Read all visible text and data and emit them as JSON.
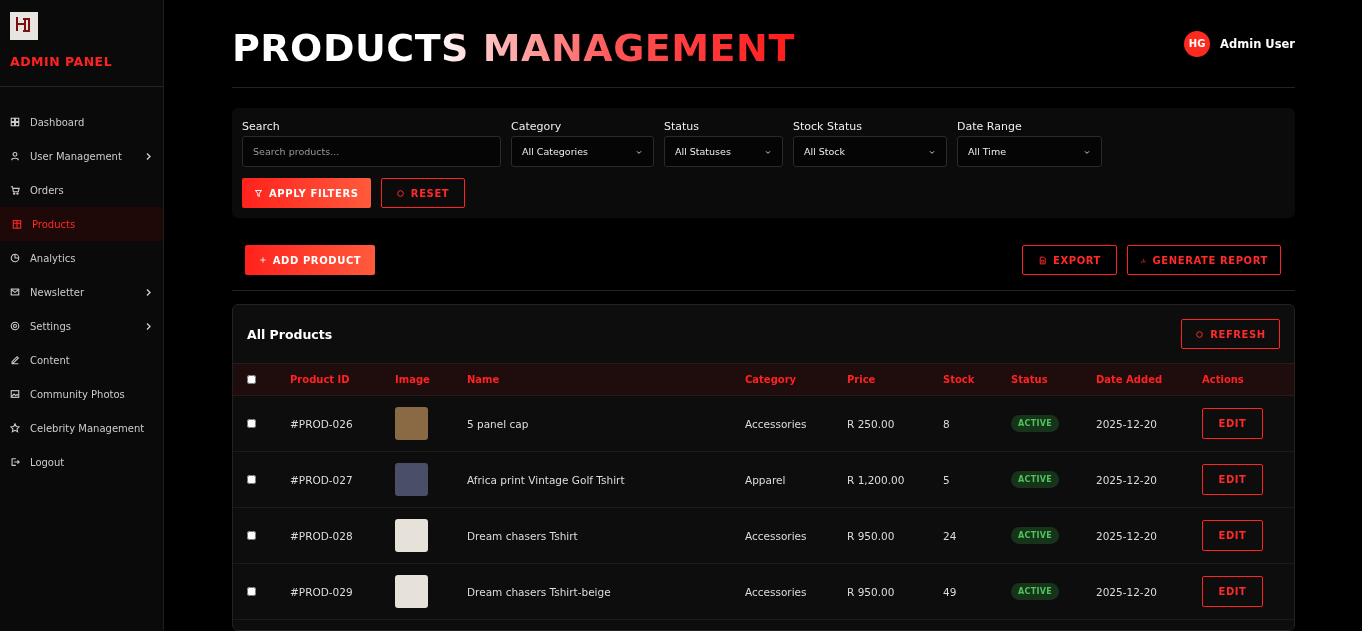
{
  "sidebar": {
    "title": "ADMIN PANEL",
    "items": [
      {
        "label": "Dashboard",
        "submenu": false,
        "selected": false
      },
      {
        "label": "User Management",
        "submenu": true,
        "selected": false
      },
      {
        "label": "Orders",
        "submenu": false,
        "selected": false
      },
      {
        "label": "Products",
        "submenu": false,
        "selected": true
      },
      {
        "label": "Analytics",
        "submenu": false,
        "selected": false
      },
      {
        "label": "Newsletter",
        "submenu": true,
        "selected": false
      },
      {
        "label": "Settings",
        "submenu": true,
        "selected": false
      },
      {
        "label": "Content",
        "submenu": false,
        "selected": false
      },
      {
        "label": "Community Photos",
        "submenu": false,
        "selected": false
      },
      {
        "label": "Celebrity Management",
        "submenu": false,
        "selected": false
      },
      {
        "label": "Logout",
        "submenu": false,
        "selected": false
      }
    ]
  },
  "header": {
    "title": "PRODUCTS MANAGEMENT",
    "user": {
      "initials": "HG",
      "name": "Admin User"
    }
  },
  "filters": {
    "fields": [
      {
        "kind": "text",
        "label": "Search",
        "placeholder": "Search products..."
      },
      {
        "kind": "select",
        "label": "Category",
        "value": "All Categories"
      },
      {
        "kind": "select",
        "label": "Status",
        "value": "All Statuses"
      },
      {
        "kind": "select",
        "label": "Stock Status",
        "value": "All Stock"
      },
      {
        "kind": "select",
        "label": "Date Range",
        "value": "All Time"
      }
    ],
    "apply_button": "APPLY FILTERS",
    "reset_button": "RESET"
  },
  "actions": {
    "add_button": "ADD PRODUCT",
    "export_button": "EXPORT",
    "report_button": "GENERATE REPORT"
  },
  "table": {
    "title": "All Products",
    "refresh_button": "REFRESH",
    "select_all_checked": false,
    "columns": [
      "Product ID",
      "Image",
      "Name",
      "Category",
      "Price",
      "Stock",
      "Status",
      "Date Added",
      "Actions"
    ],
    "rows": [
      {
        "checked": false,
        "id": "#PROD-026",
        "name": "5 panel cap",
        "category": "Accessories",
        "price": "R 250.00",
        "stock": "8",
        "status": "ACTIVE",
        "date": "2025-12-20",
        "action": "EDIT"
      },
      {
        "checked": false,
        "id": "#PROD-027",
        "name": "Africa print Vintage Golf Tshirt",
        "category": "Apparel",
        "price": "R 1,200.00",
        "stock": "5",
        "status": "ACTIVE",
        "date": "2025-12-20",
        "action": "EDIT"
      },
      {
        "checked": false,
        "id": "#PROD-028",
        "name": "Dream chasers Tshirt",
        "category": "Accessories",
        "price": "R 950.00",
        "stock": "24",
        "status": "ACTIVE",
        "date": "2025-12-20",
        "action": "EDIT"
      },
      {
        "checked": false,
        "id": "#PROD-029",
        "name": "Dream chasers Tshirt-beige",
        "category": "Accessories",
        "price": "R 950.00",
        "stock": "49",
        "status": "ACTIVE",
        "date": "2025-12-20",
        "action": "EDIT"
      }
    ]
  }
}
